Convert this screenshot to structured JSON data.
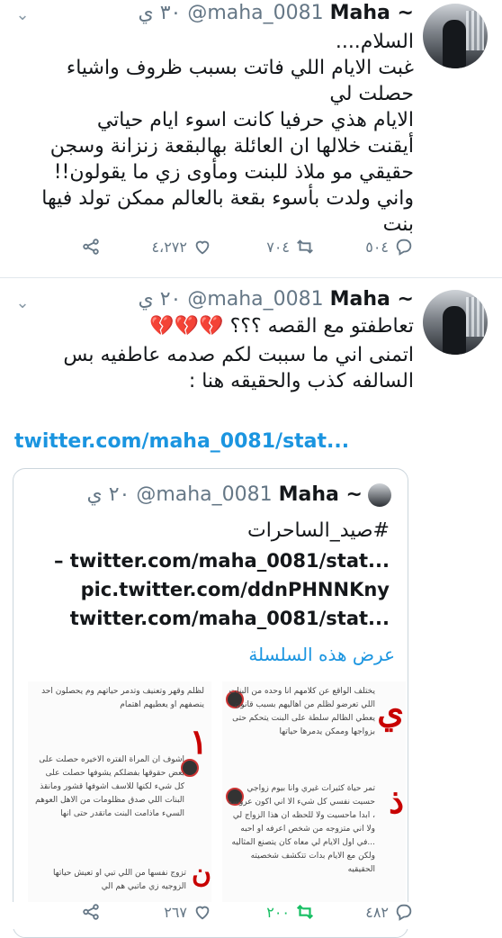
{
  "tweet1": {
    "name": "Maha ~",
    "handle": "@maha_0081",
    "time": "٣٠ ي",
    "body": "السلام....\nغبت الايام اللي فاتت بسبب ظروف واشياء حصلت لي\nالايام هذي حرفيا كانت اسوء ايام حياتي\nأيقنت خلالها ان العائلة بهالبقعة زنزانة وسجن حقيقي مو ملاذ للبنت ومأوى زي ما يقولون!!\nواني ولدت بأسوء بقعة بالعالم ممكن تولد فيها بنت",
    "actions": {
      "replies": "٥٠٤",
      "retweets": "٧٠٤",
      "likes": "٤،٢٧٢"
    }
  },
  "tweet2": {
    "name": "Maha ~",
    "handle": "@maha_0081",
    "time": "٢٠ ي",
    "body_line1": "تعاطفتو مع القصه ؟؟؟ 💔💔💔",
    "body_rest": "اتمنى اني ما سببت لكم صدمه عاطفيه بس السالفه كذب والحقيقه هنا :",
    "link": "twitter.com/maha_0081/stat...",
    "actions": {
      "replies": "٤٨٢",
      "retweets": "٢٠٠",
      "likes": "٢٦٧"
    }
  },
  "quote": {
    "name": "Maha ~",
    "handle": "@maha_0081",
    "time": "٢٠ ي",
    "hashtag": "#صيد_الساحرات",
    "line2": "– twitter.com/maha_0081/stat...",
    "line3": "pic.twitter.com/ddnPHNNKny",
    "line4": "twitter.com/maha_0081/stat...",
    "show_thread": "عرض هذه السلسلة",
    "image_right": {
      "p1": "يختلف الواقع عن كلامهم انا وحده من البنات اللي تعرضو لظلم من اهاليهم بسبب قانون يعطي الظالم سلطة على البنت يتحكم حتى بزواجها وممكن يدمرها حياتها",
      "p2": "تمر حياة كثيرات غيري وانا بيوم زواجي حسيت نفسي كل شيء الا اني اكون عروسه ، ابدا ماحسيت ولا للحظه ان هذا الزواج لي ولا اني متزوجه من شخص اعرفه او احبه ...في اول الايام لي معاه كان يتصنع المثاليه ولكن مع الايام بدات تتكشف شخصيته الحقيقيه"
    },
    "image_left": {
      "p1": "لظلم وقهر وتعنيف وتدمر حياتهم وم يحصلون احد ينصفهم او يعطيهم اهتمام",
      "p2": "اشوف ان المراة الفتره الاخيره حصلت على بعض حقوقها بفضلكم يشوفها حصلت على كل شيء لكنها للاسف اشوفها قشور ومانقذ البنات اللي صدق مظلومات من الاهل العوهم السيء ماذامت البنت ماتقدر حتى انها",
      "p3": "تزوج نفسها من اللي تبي او تعيش حياتها الزوجيه زي ماتبي هم الي"
    }
  },
  "colors": {
    "accent": "#1b95e0",
    "retweet_green": "#17bf63",
    "gray": "#657786"
  },
  "icons": [
    "share-icon",
    "like-icon",
    "retweet-icon",
    "reply-icon",
    "caret-down-icon"
  ]
}
